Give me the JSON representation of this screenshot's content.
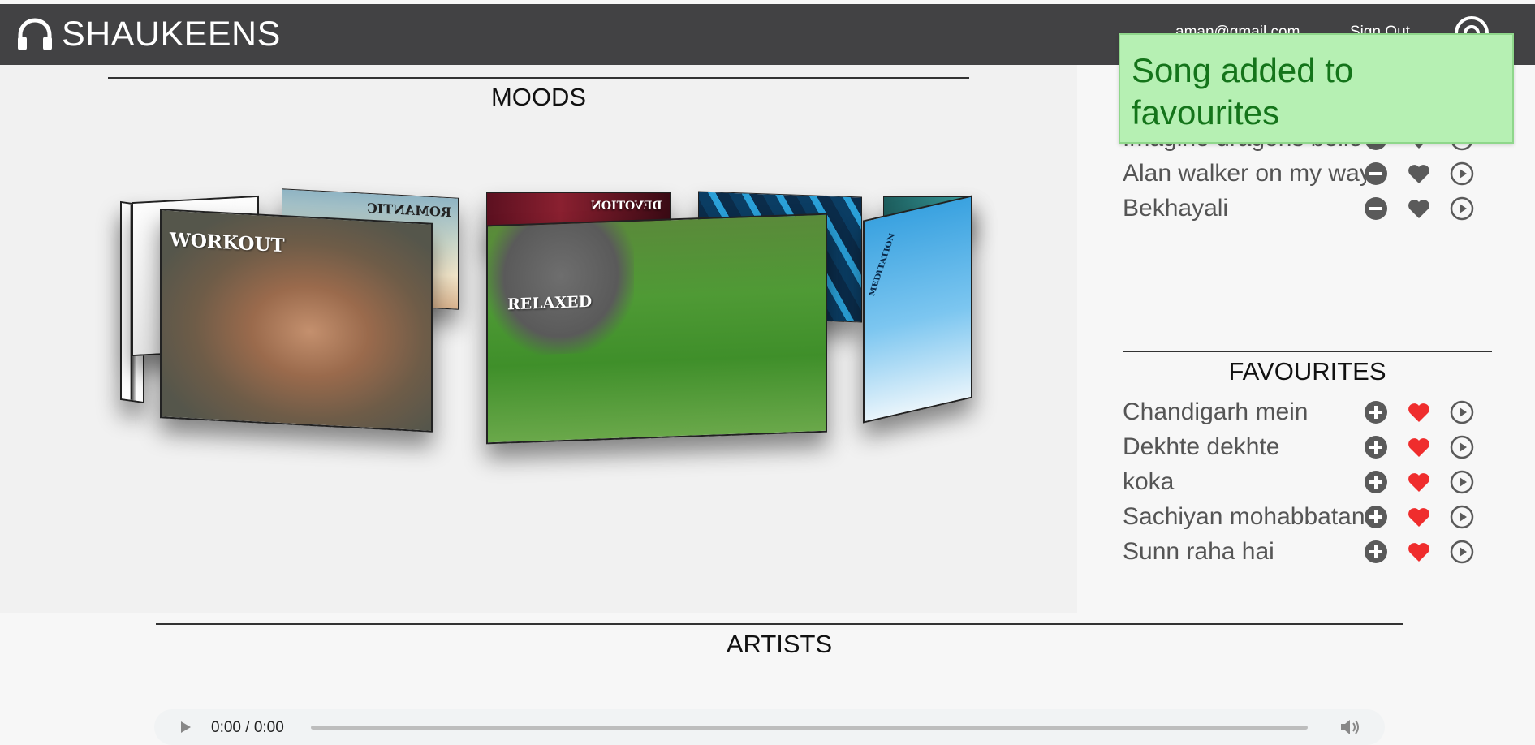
{
  "header": {
    "brand": "SHAUKEENS",
    "user_email": "aman@gmail.com",
    "sign_out": "Sign Out"
  },
  "moods": {
    "title": "MOODS",
    "cards": [
      {
        "label": "WORKOUT"
      },
      {
        "label": "ROMANTIC"
      },
      {
        "label": "DEVOTION"
      },
      {
        "label": "RELAXED"
      },
      {
        "label": "MEDITATION"
      }
    ]
  },
  "queue": {
    "items": [
      {
        "title": "Imagine dragons belie"
      },
      {
        "title": "Alan walker on my way"
      },
      {
        "title": "Bekhayali"
      }
    ]
  },
  "favourites": {
    "title": "FAVOURITES",
    "items": [
      {
        "title": "Chandigarh mein"
      },
      {
        "title": "Dekhte dekhte"
      },
      {
        "title": "koka"
      },
      {
        "title": "Sachiyan mohabbatan"
      },
      {
        "title": "Sunn raha hai"
      }
    ]
  },
  "artists": {
    "title": "ARTISTS"
  },
  "toast": {
    "message": "Song added to favourites"
  },
  "player": {
    "time": "0:00 / 0:00"
  },
  "colors": {
    "header_bg": "#424244",
    "heart_active": "#ef2d2d",
    "heart_inactive": "#5a5a5a",
    "toast_bg": "#b6f0b3",
    "toast_text": "#14741a"
  },
  "icons": [
    "headphones-icon",
    "settings-icon",
    "minus-circle-icon",
    "plus-circle-icon",
    "heart-icon",
    "play-circle-icon",
    "play-icon",
    "volume-icon"
  ]
}
